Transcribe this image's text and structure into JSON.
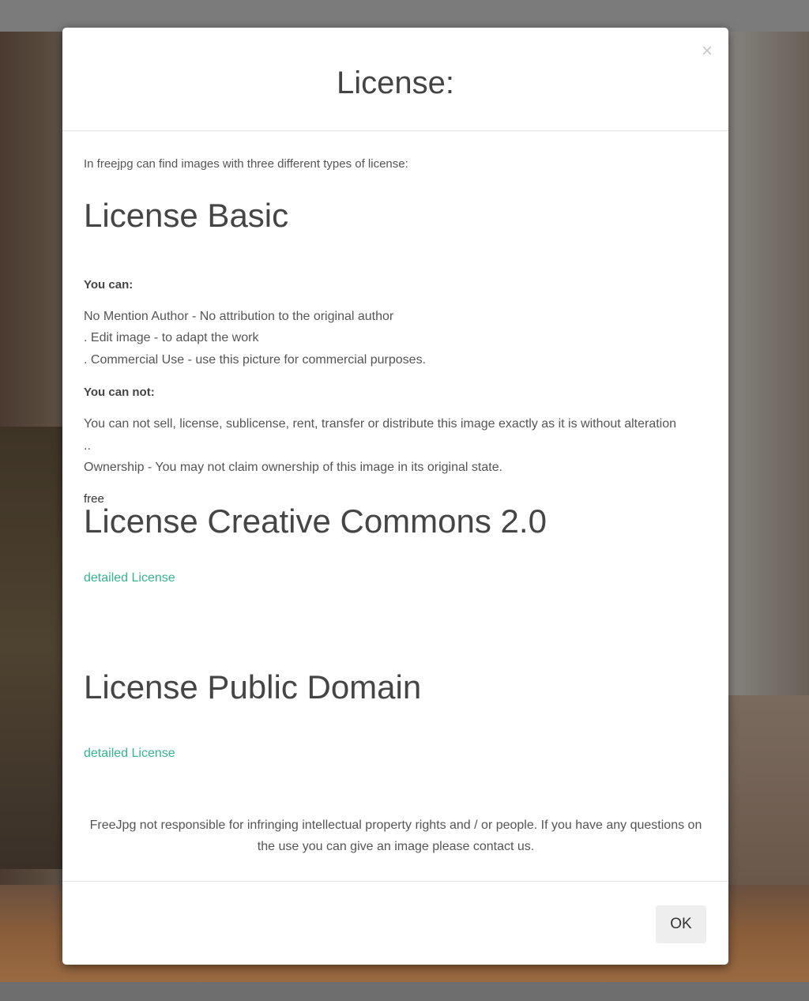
{
  "modal": {
    "title": "License:",
    "close_glyph": "×",
    "intro": "In freejpg can find images with three different types of license:",
    "basic": {
      "heading": "License Basic",
      "you_can_label": "You can:",
      "you_can_items": [
        "No Mention Author - No attribution to the original author",
        ". Edit image - to adapt the work",
        ". Commercial Use - use this picture for commercial purposes."
      ],
      "you_can_not_label": "You can not:",
      "you_can_not_text": "You can not sell, license, sublicense, rent, transfer or distribute this image exactly as it is without alteration ..",
      "ownership_text": "Ownership - You may not claim ownership of this image in its original state.",
      "free_label": "free"
    },
    "creative_commons": {
      "heading": "License Creative Commons 2.0",
      "link": "detailed License"
    },
    "public_domain": {
      "heading": "License Public Domain",
      "link": "detailed License"
    },
    "disclaimer": "FreeJpg not responsible for infringing intellectual property rights and / or people. If you have any questions on the use you can give an image please contact us.",
    "ok_label": "OK"
  },
  "colors": {
    "link": "#36b38f",
    "overlay": "#6f6f6f",
    "modal_bg": "#ffffff"
  }
}
